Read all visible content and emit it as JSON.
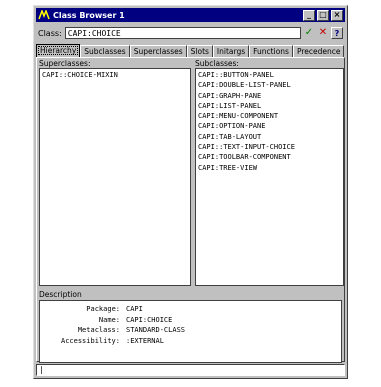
{
  "window": {
    "title": "Class Browser 1"
  },
  "titlebar_buttons": {
    "minimize": "_",
    "maximize": "□",
    "close": "×"
  },
  "class_field": {
    "label": "Class:",
    "value": "CAPI:CHOICE"
  },
  "toolbar": {
    "ok_icon": "✓",
    "cancel_icon": "✕",
    "help_icon": "?"
  },
  "tabs": [
    {
      "label": "Hierarchy",
      "active": true
    },
    {
      "label": "Subclasses"
    },
    {
      "label": "Superclasses"
    },
    {
      "label": "Slots"
    },
    {
      "label": "Initargs"
    },
    {
      "label": "Functions"
    },
    {
      "label": "Precedence"
    }
  ],
  "superclasses": {
    "label": "Superclasses:",
    "items": [
      "CAPI::CHOICE-MIXIN"
    ]
  },
  "subclasses": {
    "label": "Subclasses:",
    "items": [
      "CAPI::BUTTON-PANEL",
      "CAPI:DOUBLE-LIST-PANEL",
      "CAPI:GRAPH-PANE",
      "CAPI:LIST-PANEL",
      "CAPI:MENU-COMPONENT",
      "CAPI:OPTION-PANE",
      "CAPI:TAB-LAYOUT",
      "CAPI::TEXT-INPUT-CHOICE",
      "CAPI:TOOLBAR-COMPONENT",
      "CAPI:TREE-VIEW"
    ]
  },
  "description": {
    "label": "Description",
    "rows": [
      {
        "key": "Package:",
        "value": "CAPI"
      },
      {
        "key": "Name:",
        "value": "CAPI:CHOICE"
      },
      {
        "key": "Metaclass:",
        "value": "STANDARD-CLASS"
      },
      {
        "key": "Accessibility:",
        "value": ":EXTERNAL"
      }
    ]
  },
  "status": {
    "text": "|"
  }
}
